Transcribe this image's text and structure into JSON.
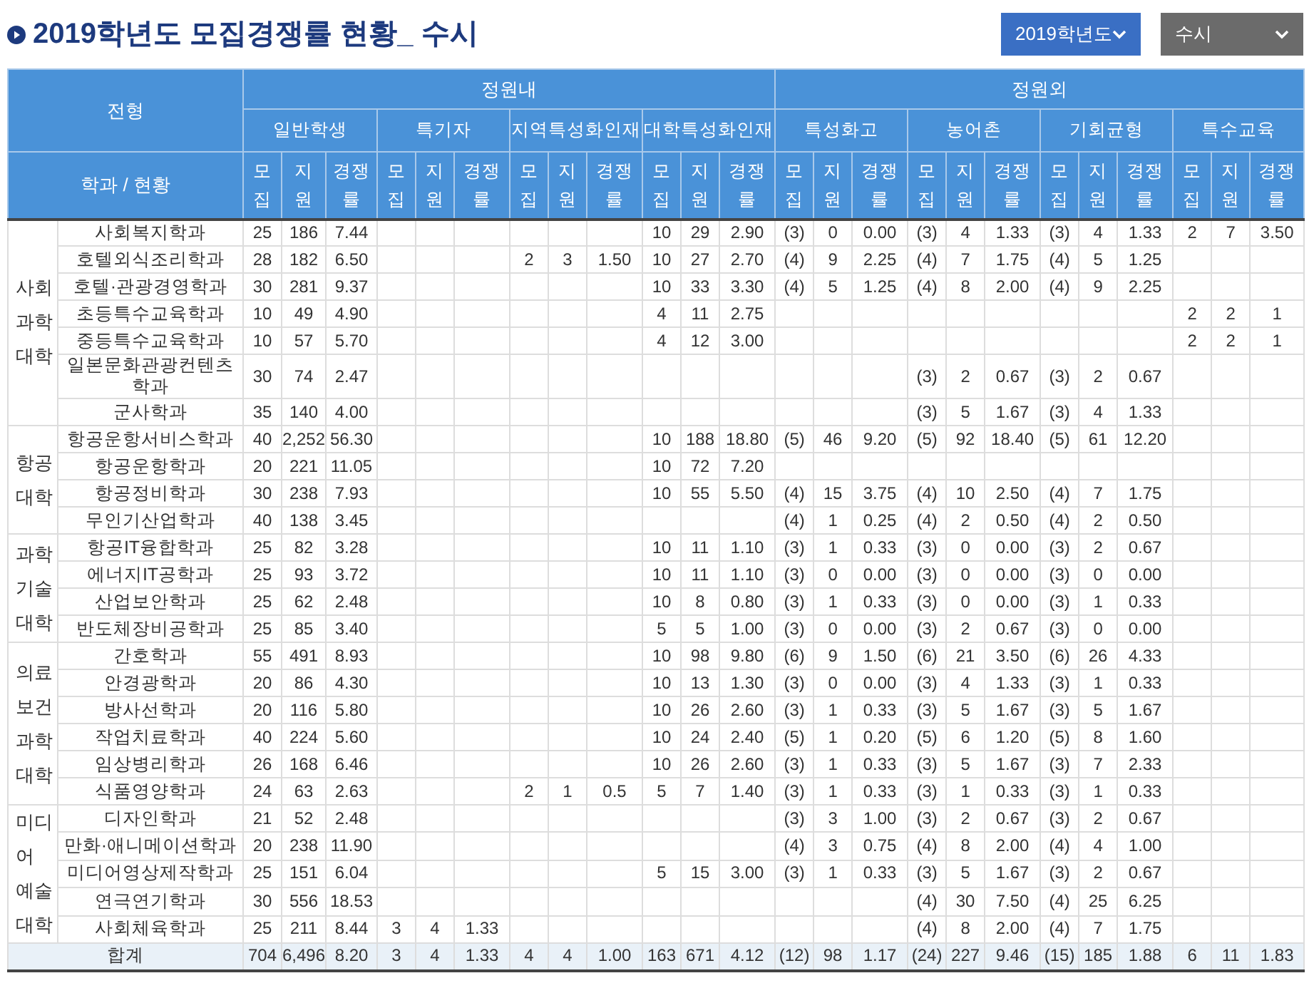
{
  "title": "2019학년도 모집경쟁률 현황_ 수시",
  "selects": [
    {
      "value": "2019학년도",
      "kind": "primary"
    },
    {
      "value": "수시",
      "kind": "secondary"
    }
  ],
  "table": {
    "type_label": "전형",
    "dept_label": "학과 / 현황",
    "groups": [
      {
        "label": "정원내",
        "subgroups": [
          {
            "label": "일반학생",
            "columns": [
              "모집",
              "지원",
              "경쟁률"
            ]
          },
          {
            "label": "특기자",
            "columns": [
              "모집",
              "지원",
              "경쟁률"
            ]
          },
          {
            "label": "지역특성화인재",
            "columns": [
              "모집",
              "지원",
              "경쟁률"
            ]
          },
          {
            "label": "대학특성화인재",
            "columns": [
              "모집",
              "지원",
              "경쟁률"
            ]
          }
        ]
      },
      {
        "label": "정원외",
        "subgroups": [
          {
            "label": "특성화고",
            "columns": [
              "모집",
              "지원",
              "경쟁률"
            ]
          },
          {
            "label": "농어촌",
            "columns": [
              "모집",
              "지원",
              "경쟁률"
            ]
          },
          {
            "label": "기회균형",
            "columns": [
              "모집",
              "지원",
              "경쟁률"
            ]
          },
          {
            "label": "특수교육",
            "columns": [
              "모집",
              "지원",
              "경쟁률"
            ]
          }
        ]
      }
    ],
    "colleges": [
      {
        "name": "사회과학대학",
        "departments": [
          {
            "name": "사회복지학과",
            "cells": [
              "25",
              "186",
              "7.44",
              null,
              null,
              null,
              null,
              null,
              null,
              "10",
              "29",
              "2.90",
              "(3)",
              "0",
              "0.00",
              "(3)",
              "4",
              "1.33",
              "(3)",
              "4",
              "1.33",
              "2",
              "7",
              "3.50"
            ]
          },
          {
            "name": "호텔외식조리학과",
            "cells": [
              "28",
              "182",
              "6.50",
              null,
              null,
              null,
              "2",
              "3",
              "1.50",
              "10",
              "27",
              "2.70",
              "(4)",
              "9",
              "2.25",
              "(4)",
              "7",
              "1.75",
              "(4)",
              "5",
              "1.25",
              null,
              null,
              null
            ]
          },
          {
            "name": "호텔·관광경영학과",
            "cells": [
              "30",
              "281",
              "9.37",
              null,
              null,
              null,
              null,
              null,
              null,
              "10",
              "33",
              "3.30",
              "(4)",
              "5",
              "1.25",
              "(4)",
              "8",
              "2.00",
              "(4)",
              "9",
              "2.25",
              null,
              null,
              null
            ]
          },
          {
            "name": "초등특수교육학과",
            "cells": [
              "10",
              "49",
              "4.90",
              null,
              null,
              null,
              null,
              null,
              null,
              "4",
              "11",
              "2.75",
              null,
              null,
              null,
              null,
              null,
              null,
              null,
              null,
              null,
              "2",
              "2",
              "1"
            ]
          },
          {
            "name": "중등특수교육학과",
            "cells": [
              "10",
              "57",
              "5.70",
              null,
              null,
              null,
              null,
              null,
              null,
              "4",
              "12",
              "3.00",
              null,
              null,
              null,
              null,
              null,
              null,
              null,
              null,
              null,
              "2",
              "2",
              "1"
            ]
          },
          {
            "name": "일본문화관광컨텐츠학과",
            "cells": [
              "30",
              "74",
              "2.47",
              null,
              null,
              null,
              null,
              null,
              null,
              null,
              null,
              null,
              null,
              null,
              null,
              "(3)",
              "2",
              "0.67",
              "(3)",
              "2",
              "0.67",
              null,
              null,
              null
            ]
          },
          {
            "name": "군사학과",
            "cells": [
              "35",
              "140",
              "4.00",
              null,
              null,
              null,
              null,
              null,
              null,
              null,
              null,
              null,
              null,
              null,
              null,
              "(3)",
              "5",
              "1.67",
              "(3)",
              "4",
              "1.33",
              null,
              null,
              null
            ]
          }
        ]
      },
      {
        "name": "항공대학",
        "departments": [
          {
            "name": "항공운항서비스학과",
            "cells": [
              "40",
              "2,252",
              "56.30",
              null,
              null,
              null,
              null,
              null,
              null,
              "10",
              "188",
              "18.80",
              "(5)",
              "46",
              "9.20",
              "(5)",
              "92",
              "18.40",
              "(5)",
              "61",
              "12.20",
              null,
              null,
              null
            ]
          },
          {
            "name": "항공운항학과",
            "cells": [
              "20",
              "221",
              "11.05",
              null,
              null,
              null,
              null,
              null,
              null,
              "10",
              "72",
              "7.20",
              null,
              null,
              null,
              null,
              null,
              null,
              null,
              null,
              null,
              null,
              null,
              null
            ]
          },
          {
            "name": "항공정비학과",
            "cells": [
              "30",
              "238",
              "7.93",
              null,
              null,
              null,
              null,
              null,
              null,
              "10",
              "55",
              "5.50",
              "(4)",
              "15",
              "3.75",
              "(4)",
              "10",
              "2.50",
              "(4)",
              "7",
              "1.75",
              null,
              null,
              null
            ]
          },
          {
            "name": "무인기산업학과",
            "cells": [
              "40",
              "138",
              "3.45",
              null,
              null,
              null,
              null,
              null,
              null,
              null,
              null,
              null,
              "(4)",
              "1",
              "0.25",
              "(4)",
              "2",
              "0.50",
              "(4)",
              "2",
              "0.50",
              null,
              null,
              null
            ]
          }
        ]
      },
      {
        "name": "과학기술대학",
        "departments": [
          {
            "name": "항공IT융합학과",
            "cells": [
              "25",
              "82",
              "3.28",
              null,
              null,
              null,
              null,
              null,
              null,
              "10",
              "11",
              "1.10",
              "(3)",
              "1",
              "0.33",
              "(3)",
              "0",
              "0.00",
              "(3)",
              "2",
              "0.67",
              null,
              null,
              null
            ]
          },
          {
            "name": "에너지IT공학과",
            "cells": [
              "25",
              "93",
              "3.72",
              null,
              null,
              null,
              null,
              null,
              null,
              "10",
              "11",
              "1.10",
              "(3)",
              "0",
              "0.00",
              "(3)",
              "0",
              "0.00",
              "(3)",
              "0",
              "0.00",
              null,
              null,
              null
            ]
          },
          {
            "name": "산업보안학과",
            "cells": [
              "25",
              "62",
              "2.48",
              null,
              null,
              null,
              null,
              null,
              null,
              "10",
              "8",
              "0.80",
              "(3)",
              "1",
              "0.33",
              "(3)",
              "0",
              "0.00",
              "(3)",
              "1",
              "0.33",
              null,
              null,
              null
            ]
          },
          {
            "name": "반도체장비공학과",
            "cells": [
              "25",
              "85",
              "3.40",
              null,
              null,
              null,
              null,
              null,
              null,
              "5",
              "5",
              "1.00",
              "(3)",
              "0",
              "0.00",
              "(3)",
              "2",
              "0.67",
              "(3)",
              "0",
              "0.00",
              null,
              null,
              null
            ]
          }
        ]
      },
      {
        "name": "의료보건과학대학",
        "departments": [
          {
            "name": "간호학과",
            "cells": [
              "55",
              "491",
              "8.93",
              null,
              null,
              null,
              null,
              null,
              null,
              "10",
              "98",
              "9.80",
              "(6)",
              "9",
              "1.50",
              "(6)",
              "21",
              "3.50",
              "(6)",
              "26",
              "4.33",
              null,
              null,
              null
            ]
          },
          {
            "name": "안경광학과",
            "cells": [
              "20",
              "86",
              "4.30",
              null,
              null,
              null,
              null,
              null,
              null,
              "10",
              "13",
              "1.30",
              "(3)",
              "0",
              "0.00",
              "(3)",
              "4",
              "1.33",
              "(3)",
              "1",
              "0.33",
              null,
              null,
              null
            ]
          },
          {
            "name": "방사선학과",
            "cells": [
              "20",
              "116",
              "5.80",
              null,
              null,
              null,
              null,
              null,
              null,
              "10",
              "26",
              "2.60",
              "(3)",
              "1",
              "0.33",
              "(3)",
              "5",
              "1.67",
              "(3)",
              "5",
              "1.67",
              null,
              null,
              null
            ]
          },
          {
            "name": "작업치료학과",
            "cells": [
              "40",
              "224",
              "5.60",
              null,
              null,
              null,
              null,
              null,
              null,
              "10",
              "24",
              "2.40",
              "(5)",
              "1",
              "0.20",
              "(5)",
              "6",
              "1.20",
              "(5)",
              "8",
              "1.60",
              null,
              null,
              null
            ]
          },
          {
            "name": "임상병리학과",
            "cells": [
              "26",
              "168",
              "6.46",
              null,
              null,
              null,
              null,
              null,
              null,
              "10",
              "26",
              "2.60",
              "(3)",
              "1",
              "0.33",
              "(3)",
              "5",
              "1.67",
              "(3)",
              "7",
              "2.33",
              null,
              null,
              null
            ]
          },
          {
            "name": "식품영양학과",
            "cells": [
              "24",
              "63",
              "2.63",
              null,
              null,
              null,
              "2",
              "1",
              "0.5",
              "5",
              "7",
              "1.40",
              "(3)",
              "1",
              "0.33",
              "(3)",
              "1",
              "0.33",
              "(3)",
              "1",
              "0.33",
              null,
              null,
              null
            ]
          }
        ]
      },
      {
        "name": "미디어 예술대학",
        "departments": [
          {
            "name": "디자인학과",
            "cells": [
              "21",
              "52",
              "2.48",
              null,
              null,
              null,
              null,
              null,
              null,
              null,
              null,
              null,
              "(3)",
              "3",
              "1.00",
              "(3)",
              "2",
              "0.67",
              "(3)",
              "2",
              "0.67",
              null,
              null,
              null
            ]
          },
          {
            "name": "만화·애니메이션학과",
            "cells": [
              "20",
              "238",
              "11.90",
              null,
              null,
              null,
              null,
              null,
              null,
              null,
              null,
              null,
              "(4)",
              "3",
              "0.75",
              "(4)",
              "8",
              "2.00",
              "(4)",
              "4",
              "1.00",
              null,
              null,
              null
            ]
          },
          {
            "name": "미디어영상제작학과",
            "cells": [
              "25",
              "151",
              "6.04",
              null,
              null,
              null,
              null,
              null,
              null,
              "5",
              "15",
              "3.00",
              "(3)",
              "1",
              "0.33",
              "(3)",
              "5",
              "1.67",
              "(3)",
              "2",
              "0.67",
              null,
              null,
              null
            ]
          },
          {
            "name": "연극연기학과",
            "cells": [
              "30",
              "556",
              "18.53",
              null,
              null,
              null,
              null,
              null,
              null,
              null,
              null,
              null,
              null,
              null,
              null,
              "(4)",
              "30",
              "7.50",
              "(4)",
              "25",
              "6.25",
              null,
              null,
              null
            ]
          },
          {
            "name": "사회체육학과",
            "cells": [
              "25",
              "211",
              "8.44",
              "3",
              "4",
              "1.33",
              null,
              null,
              null,
              null,
              null,
              null,
              null,
              null,
              null,
              "(4)",
              "8",
              "2.00",
              "(4)",
              "7",
              "1.75",
              null,
              null,
              null
            ]
          }
        ]
      }
    ],
    "total": {
      "label": "합계",
      "cells": [
        "704",
        "6,496",
        "8.20",
        "3",
        "4",
        "1.33",
        "4",
        "4",
        "1.00",
        "163",
        "671",
        "4.12",
        "(12)",
        "98",
        "1.17",
        "(24)",
        "227",
        "9.46",
        "(15)",
        "185",
        "1.88",
        "6",
        "11",
        "1.83"
      ]
    }
  }
}
